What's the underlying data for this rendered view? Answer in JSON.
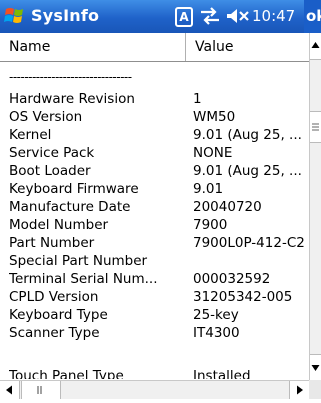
{
  "titlebar": {
    "app_title": "SysInfo",
    "input_indicator": "A",
    "clock": "10:47",
    "ok_label": "ok"
  },
  "table": {
    "columns": [
      "Name",
      "Value"
    ],
    "separator": "--------------------------------",
    "rows": [
      {
        "name": "Hardware Revision",
        "value": "1"
      },
      {
        "name": "OS Version",
        "value": "WM50"
      },
      {
        "name": "Kernel",
        "value": "9.01 (Aug 25, ..."
      },
      {
        "name": "Service Pack",
        "value": "NONE"
      },
      {
        "name": "Boot Loader",
        "value": "9.01 (Aug 25, ..."
      },
      {
        "name": "Keyboard Firmware",
        "value": "9.01"
      },
      {
        "name": "Manufacture Date",
        "value": "20040720"
      },
      {
        "name": "Model Number",
        "value": "7900"
      },
      {
        "name": "Part Number",
        "value": "7900L0P-412-C2"
      },
      {
        "name": "Special Part Number",
        "value": ""
      },
      {
        "name": "Terminal Serial Num...",
        "value": "000032592"
      },
      {
        "name": "CPLD Version",
        "value": "31205342-005"
      },
      {
        "name": "Keyboard Type",
        "value": "25-key"
      },
      {
        "name": "Scanner Type",
        "value": "IT4300"
      },
      {
        "name": "Touch Panel Type",
        "value": "Installed"
      }
    ]
  }
}
